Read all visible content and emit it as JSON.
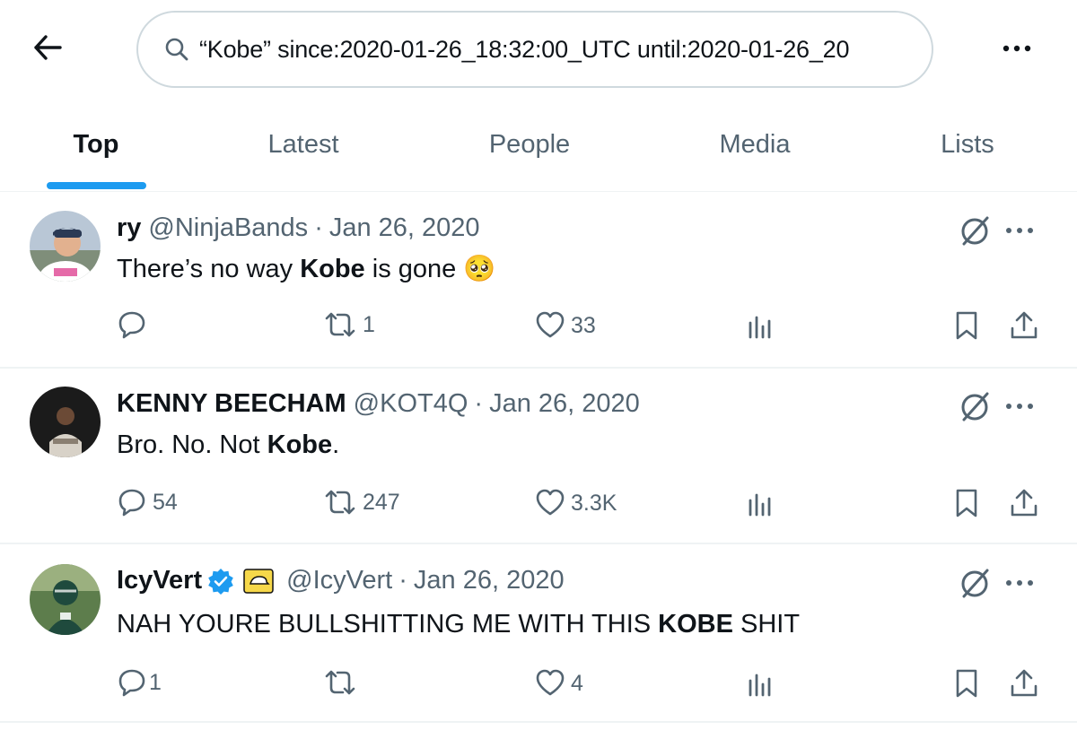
{
  "header": {
    "search_value": "“Kobe” since:2020-01-26_18:32:00_UTC until:2020-01-26_20"
  },
  "tabs": [
    {
      "label": "Top",
      "active": true
    },
    {
      "label": "Latest"
    },
    {
      "label": "People"
    },
    {
      "label": "Media"
    },
    {
      "label": "Lists"
    }
  ],
  "colors": {
    "accent": "#1d9bf0",
    "secondary_text": "#536471",
    "primary_text": "#0f1419",
    "verified": "#1d9bf0"
  },
  "tweets": [
    {
      "name": "ry",
      "handle": "@NinjaBands",
      "sep": "·",
      "date": "Jan 26, 2020",
      "text_before": "There’s no way ",
      "text_bold": "Kobe",
      "text_after": " is gone ",
      "emoji": "🥺",
      "replies": "",
      "retweets": "1",
      "likes": "33"
    },
    {
      "name": "KENNY BEECHAM",
      "handle": "@KOT4Q",
      "sep": "·",
      "date": "Jan 26, 2020",
      "text_before": "Bro. No. Not ",
      "text_bold": "Kobe",
      "text_after": ".",
      "replies": "54",
      "retweets": "247",
      "likes": "3.3K"
    },
    {
      "name": "IcyVert",
      "handle": "@IcyVert",
      "sep": "·",
      "date": "Jan 26, 2020",
      "verified": true,
      "text_before": "NAH YOURE BULLSHITTING ME WITH THIS ",
      "text_bold": "KOBE",
      "text_after": " SHIT",
      "replies": "1",
      "retweets": "",
      "likes": "4"
    }
  ]
}
